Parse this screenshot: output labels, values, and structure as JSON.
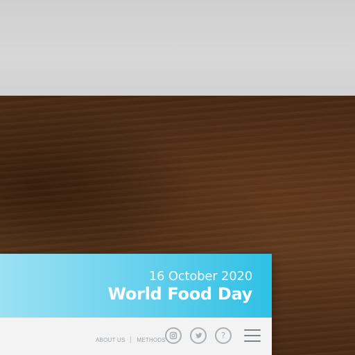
{
  "banner": {
    "date": "16 October 2020",
    "title": "World Food Day"
  },
  "nav": {
    "about_label": "ABOUT US",
    "methods_label": "METHODS"
  },
  "icons": {
    "instagram": "instagram-icon",
    "twitter": "twitter-icon",
    "help": "help-icon",
    "menu": "menu-icon"
  },
  "colors": {
    "banner_start": "#9be1f2",
    "banner_end": "#2ec0e5",
    "nav_text": "#9aa3a7",
    "icon": "#a9b0b3"
  }
}
